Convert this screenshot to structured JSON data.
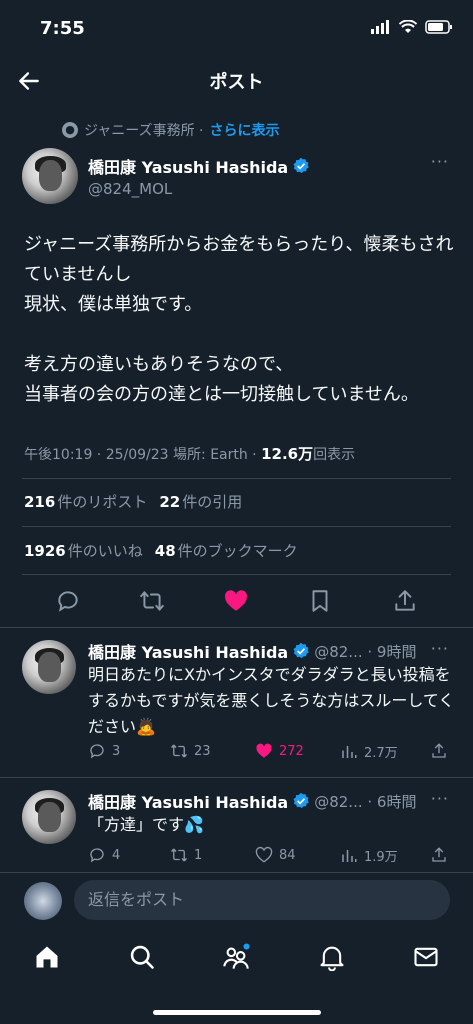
{
  "status_bar": {
    "time": "7:55"
  },
  "header": {
    "title": "ポスト"
  },
  "context": {
    "label": "ジャニーズ事務所 · ",
    "link": "さらに表示"
  },
  "post": {
    "author_name": "橋田康 Yasushi Hashida",
    "handle": "@824_MOL",
    "text": "ジャニーズ事務所からお金をもらったり、懐柔もされていませんし\n現状、僕は単独です。\n\n考え方の違いもありそうなので、\n当事者の会の方の達とは一切接触していません。",
    "meta_prefix": "午後10:19 · 25/09/23 場所: Earth · ",
    "views_count": "12.6万",
    "views_label": "回表示",
    "reposts_count": "216",
    "reposts_label": "件のリポスト",
    "quotes_count": "22",
    "quotes_label": "件の引用",
    "likes_count": "1926",
    "likes_label": "件のいいね",
    "bookmarks_count": "48",
    "bookmarks_label": "件のブックマーク",
    "more": "···"
  },
  "replies": [
    {
      "author_name": "橋田康 Yasushi Hashida",
      "sub": "@82... · 9時間",
      "text": "明日あたりにXかインスタでダラダラと長い投稿をするかもですが気を悪くしそうな方はスルーしてください🙇",
      "reply_count": "3",
      "repost_count": "23",
      "like_count": "272",
      "view_count": "2.7万",
      "liked": true
    },
    {
      "author_name": "橋田康 Yasushi Hashida",
      "sub": "@82... · 6時間",
      "text": "「方達」です💦",
      "reply_count": "4",
      "repost_count": "1",
      "like_count": "84",
      "view_count": "1.9万",
      "liked": false
    }
  ],
  "composer": {
    "placeholder": "返信をポスト"
  },
  "colors": {
    "background": "#15202b",
    "accent": "#1d9bf0",
    "like": "#f91880",
    "muted": "#8b98a5"
  },
  "icons": [
    "back-arrow-icon",
    "verified-badge-icon",
    "reply-icon",
    "repost-icon",
    "heart-icon",
    "bookmark-icon",
    "share-icon",
    "home-icon",
    "search-icon",
    "communities-icon",
    "bell-icon",
    "mail-icon"
  ]
}
